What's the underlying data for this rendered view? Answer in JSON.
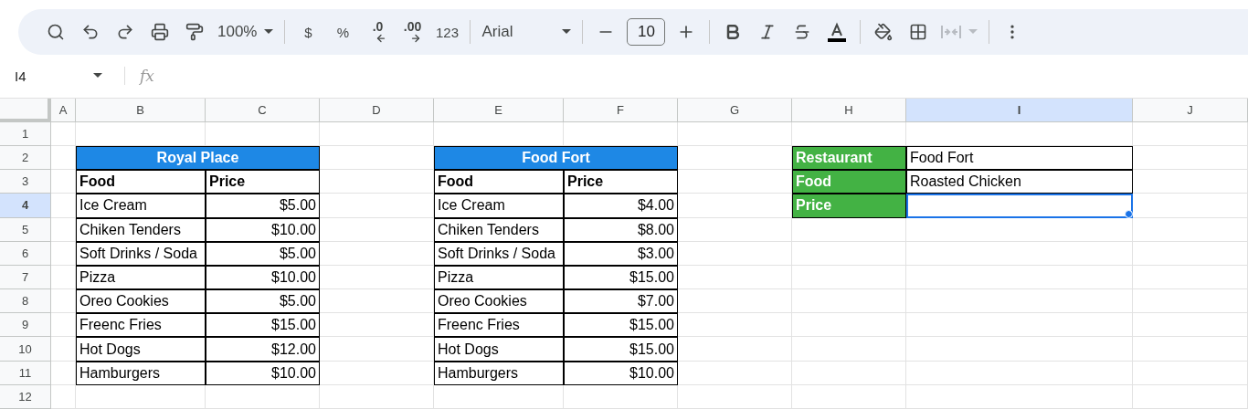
{
  "toolbar": [
    {
      "kind": "search"
    },
    {
      "kind": "undo"
    },
    {
      "kind": "redo"
    },
    {
      "kind": "print"
    },
    {
      "kind": "paint-format"
    },
    {
      "kind": "dropdown",
      "text": "100%"
    },
    {
      "kind": "separator"
    },
    {
      "kind": "text",
      "text": "$"
    },
    {
      "kind": "text",
      "text": "%"
    },
    {
      "kind": "decimal-less",
      "text": ".0"
    },
    {
      "kind": "decimal-more",
      "text": ".00"
    },
    {
      "kind": "text",
      "text": "123"
    },
    {
      "kind": "separator"
    },
    {
      "kind": "font",
      "text": "Arial"
    },
    {
      "kind": "separator"
    },
    {
      "kind": "minus"
    },
    {
      "kind": "size",
      "text": "10"
    },
    {
      "kind": "plus"
    },
    {
      "kind": "separator"
    },
    {
      "kind": "bold"
    },
    {
      "kind": "italic"
    },
    {
      "kind": "strike"
    },
    {
      "kind": "text-color"
    },
    {
      "kind": "separator"
    },
    {
      "kind": "fill"
    },
    {
      "kind": "borders"
    },
    {
      "kind": "merge",
      "disabled": true
    },
    {
      "kind": "separator"
    },
    {
      "kind": "more"
    }
  ],
  "name_box": "I4",
  "formula_label": "fx",
  "columns": [
    {
      "label": "A",
      "selected": false
    },
    {
      "label": "B",
      "selected": false
    },
    {
      "label": "C",
      "selected": false
    },
    {
      "label": "D",
      "selected": false
    },
    {
      "label": "E",
      "selected": false
    },
    {
      "label": "F",
      "selected": false
    },
    {
      "label": "G",
      "selected": false
    },
    {
      "label": "H",
      "selected": false
    },
    {
      "label": "I",
      "selected": true
    },
    {
      "label": "J",
      "selected": false
    }
  ],
  "rows": [
    {
      "number": "1",
      "selected": false,
      "cells": [
        {
          "kind": "empty"
        },
        {
          "kind": "empty"
        },
        {
          "kind": "empty"
        },
        {
          "kind": "empty"
        },
        {
          "kind": "empty"
        },
        {
          "kind": "empty"
        },
        {
          "kind": "empty"
        },
        {
          "kind": "empty"
        },
        {
          "kind": "empty"
        },
        {
          "kind": "empty"
        }
      ]
    },
    {
      "number": "2",
      "selected": false,
      "cells": [
        {
          "kind": "empty"
        },
        {
          "kind": "title",
          "text": "Royal Place"
        },
        {
          "kind": "merged"
        },
        {
          "kind": "empty"
        },
        {
          "kind": "title",
          "text": "Food Fort"
        },
        {
          "kind": "merged"
        },
        {
          "kind": "empty"
        },
        {
          "kind": "label",
          "text": "Restaurant"
        },
        {
          "kind": "text",
          "text": "Food Fort",
          "selected": false
        },
        {
          "kind": "empty"
        }
      ]
    },
    {
      "number": "3",
      "selected": false,
      "cells": [
        {
          "kind": "empty"
        },
        {
          "kind": "header",
          "text": "Food"
        },
        {
          "kind": "header",
          "text": "Price"
        },
        {
          "kind": "empty"
        },
        {
          "kind": "header",
          "text": "Food"
        },
        {
          "kind": "header",
          "text": "Price"
        },
        {
          "kind": "empty"
        },
        {
          "kind": "label",
          "text": "Food"
        },
        {
          "kind": "text",
          "text": "Roasted Chicken",
          "selected": false
        },
        {
          "kind": "empty"
        }
      ]
    },
    {
      "number": "4",
      "selected": true,
      "cells": [
        {
          "kind": "empty"
        },
        {
          "kind": "text",
          "text": "Ice Cream"
        },
        {
          "kind": "money",
          "text": "$5.00"
        },
        {
          "kind": "empty"
        },
        {
          "kind": "text",
          "text": "Ice Cream"
        },
        {
          "kind": "money",
          "text": "$4.00"
        },
        {
          "kind": "empty"
        },
        {
          "kind": "label",
          "text": "Price"
        },
        {
          "kind": "text",
          "selected": true
        },
        {
          "kind": "empty"
        }
      ]
    },
    {
      "number": "5",
      "selected": false,
      "cells": [
        {
          "kind": "empty"
        },
        {
          "kind": "text",
          "text": "Chiken Tenders"
        },
        {
          "kind": "money",
          "text": "$10.00"
        },
        {
          "kind": "empty"
        },
        {
          "kind": "text",
          "text": "Chiken Tenders"
        },
        {
          "kind": "money",
          "text": "$8.00"
        },
        {
          "kind": "empty"
        },
        {
          "kind": "empty"
        },
        {
          "kind": "empty"
        },
        {
          "kind": "empty"
        }
      ]
    },
    {
      "number": "6",
      "selected": false,
      "cells": [
        {
          "kind": "empty"
        },
        {
          "kind": "text",
          "text": "Soft Drinks / Soda"
        },
        {
          "kind": "money",
          "text": "$5.00"
        },
        {
          "kind": "empty"
        },
        {
          "kind": "text",
          "text": "Soft Drinks / Soda"
        },
        {
          "kind": "money",
          "text": "$3.00"
        },
        {
          "kind": "empty"
        },
        {
          "kind": "empty"
        },
        {
          "kind": "empty"
        },
        {
          "kind": "empty"
        }
      ]
    },
    {
      "number": "7",
      "selected": false,
      "cells": [
        {
          "kind": "empty"
        },
        {
          "kind": "text",
          "text": "Pizza"
        },
        {
          "kind": "money",
          "text": "$10.00"
        },
        {
          "kind": "empty"
        },
        {
          "kind": "text",
          "text": "Pizza"
        },
        {
          "kind": "money",
          "text": "$15.00"
        },
        {
          "kind": "empty"
        },
        {
          "kind": "empty"
        },
        {
          "kind": "empty"
        },
        {
          "kind": "empty"
        }
      ]
    },
    {
      "number": "8",
      "selected": false,
      "cells": [
        {
          "kind": "empty"
        },
        {
          "kind": "text",
          "text": "Oreo Cookies"
        },
        {
          "kind": "money",
          "text": "$5.00"
        },
        {
          "kind": "empty"
        },
        {
          "kind": "text",
          "text": "Oreo Cookies"
        },
        {
          "kind": "money",
          "text": "$7.00"
        },
        {
          "kind": "empty"
        },
        {
          "kind": "empty"
        },
        {
          "kind": "empty"
        },
        {
          "kind": "empty"
        }
      ]
    },
    {
      "number": "9",
      "selected": false,
      "cells": [
        {
          "kind": "empty"
        },
        {
          "kind": "text",
          "text": "Freenc Fries"
        },
        {
          "kind": "money",
          "text": "$15.00"
        },
        {
          "kind": "empty"
        },
        {
          "kind": "text",
          "text": "Freenc Fries"
        },
        {
          "kind": "money",
          "text": "$15.00"
        },
        {
          "kind": "empty"
        },
        {
          "kind": "empty"
        },
        {
          "kind": "empty"
        },
        {
          "kind": "empty"
        }
      ]
    },
    {
      "number": "10",
      "selected": false,
      "cells": [
        {
          "kind": "empty"
        },
        {
          "kind": "text",
          "text": "Hot Dogs"
        },
        {
          "kind": "money",
          "text": "$12.00"
        },
        {
          "kind": "empty"
        },
        {
          "kind": "text",
          "text": "Hot Dogs"
        },
        {
          "kind": "money",
          "text": "$15.00"
        },
        {
          "kind": "empty"
        },
        {
          "kind": "empty"
        },
        {
          "kind": "empty"
        },
        {
          "kind": "empty"
        }
      ]
    },
    {
      "number": "11",
      "selected": false,
      "cells": [
        {
          "kind": "empty"
        },
        {
          "kind": "text",
          "text": "Hamburgers"
        },
        {
          "kind": "money",
          "text": "$10.00"
        },
        {
          "kind": "empty"
        },
        {
          "kind": "text",
          "text": "Hamburgers"
        },
        {
          "kind": "money",
          "text": "$10.00"
        },
        {
          "kind": "empty"
        },
        {
          "kind": "empty"
        },
        {
          "kind": "empty"
        },
        {
          "kind": "empty"
        }
      ]
    },
    {
      "number": "12",
      "selected": false,
      "cells": [
        {
          "kind": "empty"
        },
        {
          "kind": "empty"
        },
        {
          "kind": "empty"
        },
        {
          "kind": "empty"
        },
        {
          "kind": "empty"
        },
        {
          "kind": "empty"
        },
        {
          "kind": "empty"
        },
        {
          "kind": "empty"
        },
        {
          "kind": "empty"
        },
        {
          "kind": "empty"
        }
      ]
    }
  ]
}
